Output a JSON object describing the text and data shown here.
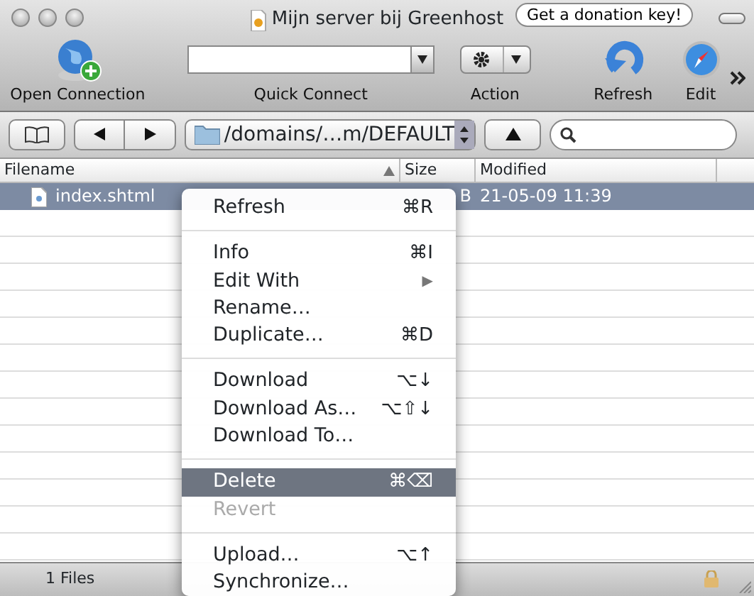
{
  "window": {
    "title": "Mijn server bij Greenhost",
    "donation_button": "Get a donation key!"
  },
  "toolbar": [
    {
      "kind": "connection",
      "label": "Open Connection"
    },
    {
      "kind": "quickconnect",
      "label": "Quick Connect"
    },
    {
      "kind": "action",
      "label": "Action"
    },
    {
      "kind": "refresh",
      "label": "Refresh"
    },
    {
      "kind": "edit",
      "label": "Edit"
    }
  ],
  "navigation": {
    "path": "/domains/…m/DEFAULT"
  },
  "table": {
    "columns": [
      {
        "label": "Filename",
        "sorted": true
      },
      {
        "label": "Size",
        "sorted": false
      },
      {
        "label": "Modified",
        "sorted": false
      }
    ],
    "rows": [
      {
        "name": "index.shtml",
        "size": "B",
        "modified": "21-05-09 11:39",
        "selected": true
      }
    ]
  },
  "context_menu": [
    {
      "kind": "item",
      "label": "Refresh",
      "shortcut": "⌘R",
      "selected": false,
      "disabled": false
    },
    {
      "kind": "separator"
    },
    {
      "kind": "item",
      "label": "Info",
      "shortcut": "⌘I",
      "selected": false,
      "disabled": false
    },
    {
      "kind": "submenu",
      "label": "Edit With",
      "shortcut": "▶",
      "selected": false,
      "disabled": false
    },
    {
      "kind": "item",
      "label": "Rename…",
      "selected": false,
      "disabled": false
    },
    {
      "kind": "item",
      "label": "Duplicate…",
      "shortcut": "⌘D",
      "selected": false,
      "disabled": false
    },
    {
      "kind": "separator"
    },
    {
      "kind": "item",
      "label": "Download",
      "shortcut": "⌥↓",
      "selected": false,
      "disabled": false
    },
    {
      "kind": "item",
      "label": "Download As…",
      "shortcut": "⌥⇧↓",
      "selected": false,
      "disabled": false
    },
    {
      "kind": "item",
      "label": "Download To…",
      "selected": false,
      "disabled": false
    },
    {
      "kind": "separator"
    },
    {
      "kind": "item",
      "label": "Delete",
      "shortcut": "⌘⌫",
      "selected": true,
      "disabled": false
    },
    {
      "kind": "item",
      "label": "Revert",
      "selected": false,
      "disabled": true
    },
    {
      "kind": "separator"
    },
    {
      "kind": "item",
      "label": "Upload…",
      "shortcut": "⌥↑",
      "selected": false,
      "disabled": false
    },
    {
      "kind": "item",
      "label": "Synchronize…",
      "selected": false,
      "disabled": false
    }
  ],
  "status_bar": {
    "text": "1 Files"
  }
}
